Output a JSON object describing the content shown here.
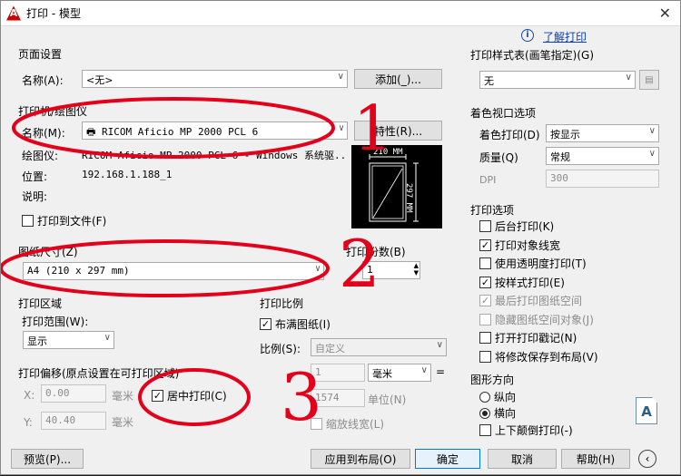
{
  "window": {
    "title": "打印 - 模型",
    "close": "✕"
  },
  "help": {
    "link": "了解打印"
  },
  "page_setup": {
    "group": "页面设置",
    "name_label": "名称(A):",
    "name_value": "<无>",
    "add_button": "添加(_)..."
  },
  "printer": {
    "group": "打印机/绘图仪",
    "name_label": "名称(M):",
    "name_value": "RICOM Aficio MP 2000 PCL 6",
    "properties_button": "特性(R)...",
    "plotter_label": "绘图仪:",
    "plotter_value": "RICOM Aficio MP 2000 PCL 6 - Windows 系统驱...",
    "location_label": "位置:",
    "location_value": "192.168.1.188_1",
    "description_label": "说明:",
    "print_to_file": "打印到文件(F)",
    "preview_width": "210 MM",
    "preview_height": "297 MM"
  },
  "paper": {
    "group": "图纸尺寸(Z)",
    "value": "A4 (210 x 297 mm)"
  },
  "copies": {
    "label": "打印份数(B)",
    "value": "1"
  },
  "area": {
    "group": "打印区域",
    "range_label": "打印范围(W):",
    "range_value": "显示"
  },
  "offset": {
    "group": "打印偏移(原点设置在可打印区域)",
    "x_label": "X:",
    "x_value": "0.00",
    "x_unit": "毫米",
    "y_label": "Y:",
    "y_value": "40.40",
    "y_unit": "毫米",
    "center": "居中打印(C)"
  },
  "scale": {
    "group": "打印比例",
    "fit": "布满图纸(I)",
    "scale_label": "比例(S):",
    "scale_value": "自定义",
    "value1": "1",
    "unit1": "毫米",
    "equals": "=",
    "value2": "1574",
    "unit2": "单位(N)",
    "lineweights": "缩放线宽(L)"
  },
  "style_table": {
    "group": "打印样式表(画笔指定)(G)",
    "value": "无"
  },
  "shaded": {
    "group": "着色视口选项",
    "shade_label": "着色打印(D)",
    "shade_value": "按显示",
    "quality_label": "质量(Q)",
    "quality_value": "常规",
    "dpi_label": "DPI",
    "dpi_value": "300"
  },
  "options": {
    "group": "打印选项",
    "items": [
      {
        "label": "后台打印(K)",
        "checked": false,
        "disabled": false
      },
      {
        "label": "打印对象线宽",
        "checked": true,
        "disabled": false
      },
      {
        "label": "使用透明度打印(T)",
        "checked": false,
        "disabled": false
      },
      {
        "label": "按样式打印(E)",
        "checked": true,
        "disabled": false
      },
      {
        "label": "最后打印图纸空间",
        "checked": true,
        "disabled": true
      },
      {
        "label": "隐藏图纸空间对象(J)",
        "checked": false,
        "disabled": true
      },
      {
        "label": "打开打印戳记(N)",
        "checked": false,
        "disabled": false
      },
      {
        "label": "将修改保存到布局(V)",
        "checked": false,
        "disabled": false
      }
    ]
  },
  "orientation": {
    "group": "图形方向",
    "portrait": "纵向",
    "landscape": "横向",
    "upside_down": "上下颠倒打印(-)",
    "icon_letter": "A"
  },
  "buttons": {
    "preview": "预览(P)...",
    "apply": "应用到布局(O)",
    "ok": "确定",
    "cancel": "取消",
    "help": "帮助(H)"
  },
  "annotations": {
    "n1": "1",
    "n2": "2",
    "n3": "3",
    "color": "#e3001b"
  }
}
